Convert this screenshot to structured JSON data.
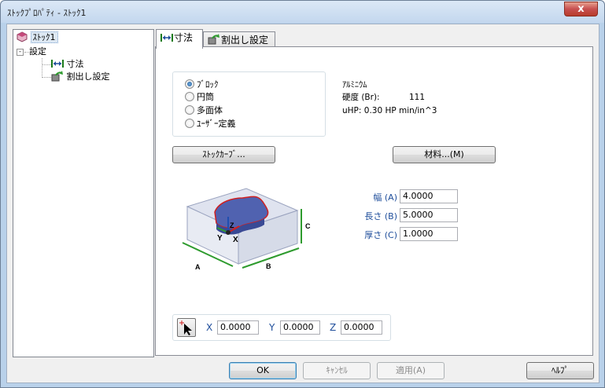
{
  "window": {
    "title": "ｽﾄｯｸﾌﾟﾛﾊﾟﾃｨ - ｽﾄｯｸ1",
    "close_label": "x"
  },
  "tree": {
    "root": "ｽﾄｯｸ1",
    "expander": "-",
    "settings": "設定",
    "child_dimensions": "寸法",
    "child_index": "割出し設定"
  },
  "tabs": [
    {
      "label": "寸法",
      "active": true
    },
    {
      "label": "割出し設定",
      "active": false
    }
  ],
  "shape": {
    "options": [
      "ﾌﾞﾛｯｸ",
      "円筒",
      "多面体",
      "ﾕｰｻﾞｰ定義"
    ],
    "selected": "ﾌﾞﾛｯｸ"
  },
  "material": {
    "name": "ｱﾙﾐﾆｳﾑ",
    "hardness_label": "硬度 (Br):",
    "hardness_value": "111",
    "uhp": "uHP: 0.30 HP min/in^3"
  },
  "buttons": {
    "stock_curve": "ｽﾄｯｸｶｰﾌﾞ...",
    "material": "材料...(M)",
    "ok": "OK",
    "cancel": "ｷｬﾝｾﾙ",
    "apply": "適用(A)",
    "help": "ﾍﾙﾌﾟ"
  },
  "dimensions": {
    "width_label": "幅 (A)",
    "width_value": "4.0000",
    "length_label": "長さ (B)",
    "length_value": "5.0000",
    "thickness_label": "厚さ (C)",
    "thickness_value": "1.0000"
  },
  "diagram": {
    "label_a": "A",
    "label_b": "B",
    "label_c": "C",
    "axis_x": "X",
    "axis_y": "Y",
    "axis_z": "Z"
  },
  "origin": {
    "x_label": "X",
    "x_value": "0.0000",
    "y_label": "Y",
    "y_value": "0.0000",
    "z_label": "Z",
    "z_value": "0.0000"
  },
  "colors": {
    "accent_blue": "#1f4e9b",
    "part_blue": "#4a5fb0",
    "part_outline": "#d02020",
    "dim_green": "#2e9b2e"
  }
}
